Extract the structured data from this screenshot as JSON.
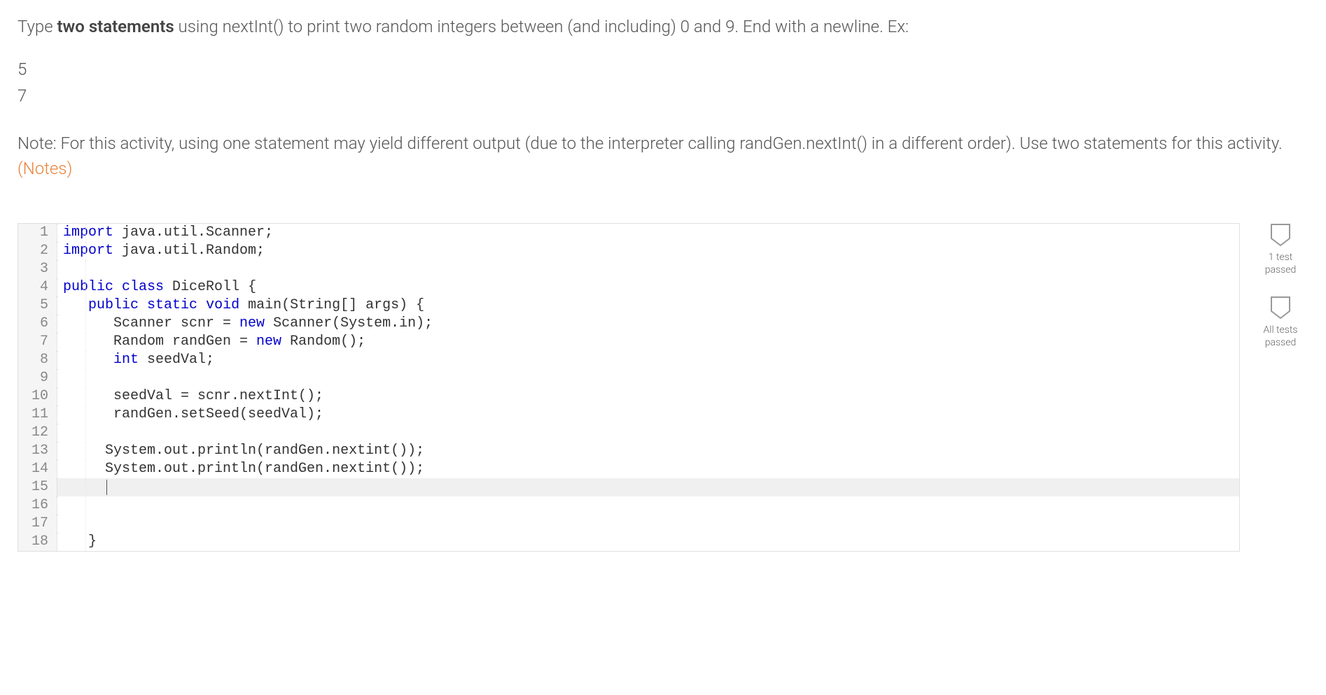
{
  "instruction": {
    "prefix": "Type ",
    "bold": "two statements",
    "suffix": " using nextInt() to print two random integers between (and including) 0 and 9. End with a newline. Ex:"
  },
  "example": {
    "line1": "5",
    "line2": "7"
  },
  "note": {
    "text": "Note: For this activity, using one statement may yield different output (due to the interpreter calling randGen.nextInt() in a different order). Use two statements for this activity. ",
    "link": "(Notes)"
  },
  "code": {
    "lines": [
      {
        "n": "1",
        "tokens": [
          {
            "t": "import",
            "c": "kw"
          },
          {
            "t": " java.util.Scanner;"
          }
        ]
      },
      {
        "n": "2",
        "tokens": [
          {
            "t": "import",
            "c": "kw"
          },
          {
            "t": " java.util.Random;"
          }
        ]
      },
      {
        "n": "3",
        "tokens": []
      },
      {
        "n": "4",
        "tokens": [
          {
            "t": "public",
            "c": "kw"
          },
          {
            "t": " "
          },
          {
            "t": "class",
            "c": "kw"
          },
          {
            "t": " DiceRoll {"
          }
        ]
      },
      {
        "n": "5",
        "tokens": [
          {
            "t": "   "
          },
          {
            "t": "public",
            "c": "kw"
          },
          {
            "t": " "
          },
          {
            "t": "static",
            "c": "kw"
          },
          {
            "t": " "
          },
          {
            "t": "void",
            "c": "kw"
          },
          {
            "t": " main(String[] args) {"
          }
        ]
      },
      {
        "n": "6",
        "tokens": [
          {
            "t": "      Scanner scnr = "
          },
          {
            "t": "new",
            "c": "kw"
          },
          {
            "t": " Scanner(System.in);"
          }
        ]
      },
      {
        "n": "7",
        "tokens": [
          {
            "t": "      Random randGen = "
          },
          {
            "t": "new",
            "c": "kw"
          },
          {
            "t": " Random();"
          }
        ]
      },
      {
        "n": "8",
        "tokens": [
          {
            "t": "      "
          },
          {
            "t": "int",
            "c": "kw"
          },
          {
            "t": " seedVal;"
          }
        ]
      },
      {
        "n": "9",
        "tokens": []
      },
      {
        "n": "10",
        "tokens": [
          {
            "t": "      seedVal = scnr.nextInt();"
          }
        ]
      },
      {
        "n": "11",
        "tokens": [
          {
            "t": "      randGen.setSeed(seedVal);"
          }
        ]
      },
      {
        "n": "12",
        "tokens": []
      },
      {
        "n": "13",
        "tokens": [
          {
            "t": "     System.out.println(randGen.nextint());"
          }
        ]
      },
      {
        "n": "14",
        "tokens": [
          {
            "t": "     System.out.println(randGen.nextint());"
          }
        ]
      },
      {
        "n": "15",
        "tokens": [
          {
            "t": "     "
          }
        ],
        "active": true,
        "cursor": true
      },
      {
        "n": "16",
        "tokens": []
      },
      {
        "n": "17",
        "tokens": []
      },
      {
        "n": "18",
        "tokens": [
          {
            "t": "   }"
          }
        ]
      }
    ]
  },
  "badges": {
    "test1": {
      "line1": "1 test",
      "line2": "passed"
    },
    "test2": {
      "line1": "All tests",
      "line2": "passed"
    }
  }
}
